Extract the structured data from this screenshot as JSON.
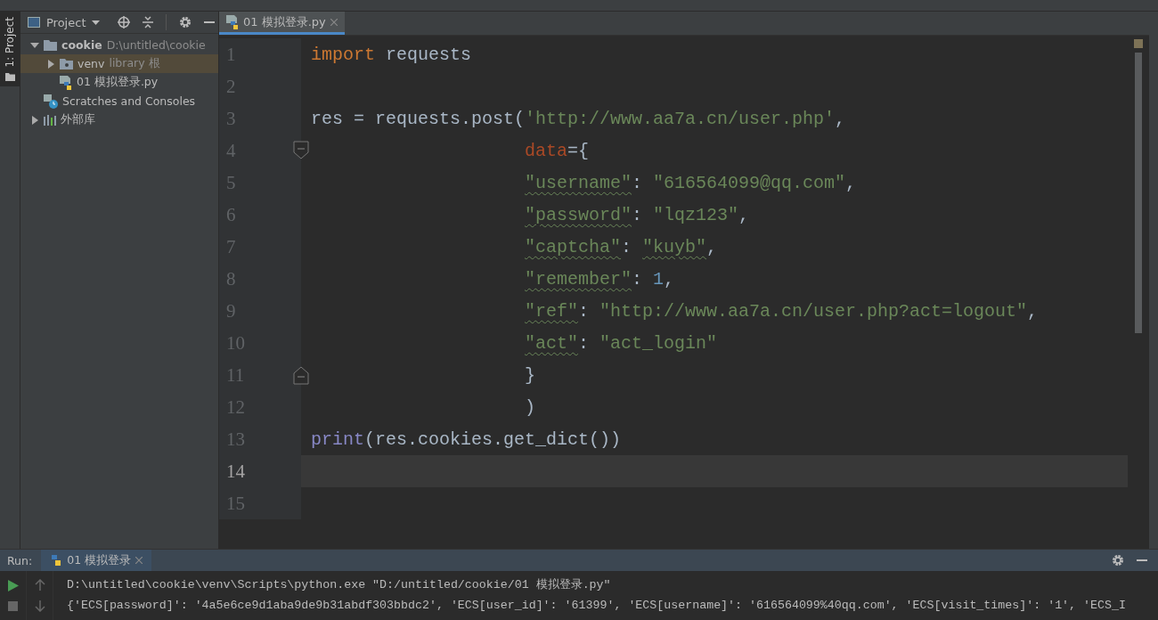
{
  "side_tab": {
    "label": "1: Project"
  },
  "project_panel": {
    "title": "Project"
  },
  "tree": [
    {
      "label": "cookie",
      "hint": "D:\\untitled\\cookie",
      "kind": "folder",
      "expanded": true,
      "selected": false,
      "children": [
        {
          "label": "venv",
          "hint": "library 根",
          "kind": "venv",
          "expanded": false,
          "selected": true
        },
        {
          "label": "01 模拟登录.py",
          "kind": "python",
          "selected": false
        }
      ]
    },
    {
      "label": "Scratches and Consoles",
      "kind": "scratches",
      "selected": false
    },
    {
      "label": "外部库",
      "kind": "library",
      "expanded": false,
      "selected": false
    }
  ],
  "editor_tabs": [
    {
      "label": "01 模拟登录.py",
      "selected": true
    }
  ],
  "code_lines": [
    {
      "number": "1",
      "tokens": [
        {
          "kind": "keyword",
          "text": "import"
        },
        {
          "kind": "plain",
          "text": " requests"
        }
      ]
    },
    {
      "number": "2"
    },
    {
      "number": "3",
      "tokens": [
        {
          "kind": "plain",
          "text": "res = requests.post("
        },
        {
          "kind": "string",
          "text": "'http://www.aa7a.cn/user.php'"
        },
        {
          "kind": "plain",
          "text": ","
        }
      ]
    },
    {
      "number": "4",
      "indented": true,
      "kind": "fold_start",
      "tokens": [
        {
          "kind": "param",
          "text": "data"
        },
        {
          "kind": "plain",
          "text": "={"
        }
      ]
    },
    {
      "number": "5",
      "indented": true,
      "tokens": [
        {
          "kind": "key",
          "text": "\"username\""
        },
        {
          "kind": "plain",
          "text": ": "
        },
        {
          "kind": "string",
          "text": "\"616564099@qq.com\""
        },
        {
          "kind": "plain",
          "text": ","
        }
      ]
    },
    {
      "number": "6",
      "indented": true,
      "tokens": [
        {
          "kind": "key",
          "text": "\"password\""
        },
        {
          "kind": "plain",
          "text": ": "
        },
        {
          "kind": "string",
          "text": "\"lqz123\""
        },
        {
          "kind": "plain",
          "text": ","
        }
      ]
    },
    {
      "number": "7",
      "indented": true,
      "tokens": [
        {
          "kind": "key",
          "text": "\"captcha\""
        },
        {
          "kind": "plain",
          "text": ": "
        },
        {
          "kind": "key",
          "text": "\"kuyb\""
        },
        {
          "kind": "plain",
          "text": ","
        }
      ]
    },
    {
      "number": "8",
      "indented": true,
      "tokens": [
        {
          "kind": "key",
          "text": "\"remember\""
        },
        {
          "kind": "plain",
          "text": ": "
        },
        {
          "kind": "number",
          "text": "1"
        },
        {
          "kind": "plain",
          "text": ","
        }
      ]
    },
    {
      "number": "9",
      "indented": true,
      "tokens": [
        {
          "kind": "key",
          "text": "\"ref\""
        },
        {
          "kind": "plain",
          "text": ": "
        },
        {
          "kind": "string",
          "text": "\"http://www.aa7a.cn/user.php?act=logout\""
        },
        {
          "kind": "plain",
          "text": ","
        }
      ]
    },
    {
      "number": "10",
      "indented": true,
      "tokens": [
        {
          "kind": "key",
          "text": "\"act\""
        },
        {
          "kind": "plain",
          "text": ": "
        },
        {
          "kind": "string",
          "text": "\"act_login\""
        }
      ]
    },
    {
      "number": "11",
      "indented": true,
      "kind": "fold_end",
      "tokens": [
        {
          "kind": "plain",
          "text": "}"
        }
      ]
    },
    {
      "number": "12",
      "indented": true,
      "tokens": [
        {
          "kind": "plain",
          "text": ")"
        }
      ]
    },
    {
      "number": "13",
      "tokens": [
        {
          "kind": "builtin",
          "text": "print"
        },
        {
          "kind": "plain",
          "text": "(res.cookies.get_dict())"
        }
      ]
    },
    {
      "number": "14",
      "current": true
    },
    {
      "number": "15"
    }
  ],
  "run_panel": {
    "label": "Run:",
    "tabs": [
      {
        "label": "01 模拟登录",
        "selected": true
      }
    ],
    "output": [
      "D:\\untitled\\cookie\\venv\\Scripts\\python.exe \"D:/untitled/cookie/01 模拟登录.py\"",
      "{'ECS[password]': '4a5e6ce9d1aba9de9b31abdf303bbdc2', 'ECS[user_id]': '61399', 'ECS[username]': '616564099%40qq.com', 'ECS[visit_times]': '1', 'ECS_I"
    ]
  }
}
